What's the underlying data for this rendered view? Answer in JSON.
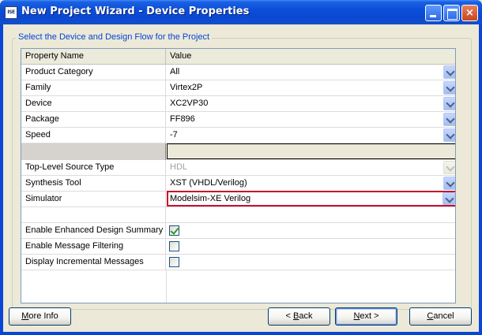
{
  "window": {
    "title": "New Project Wizard - Device Properties",
    "icon": "ISE"
  },
  "group": {
    "label": "Select the Device and Design Flow for the Project"
  },
  "grid": {
    "columns": [
      "Property Name",
      "Value"
    ],
    "rows": [
      {
        "name": "Product Category",
        "value": "All",
        "type": "combo"
      },
      {
        "name": "Family",
        "value": "Virtex2P",
        "type": "combo"
      },
      {
        "name": "Device",
        "value": "XC2VP30",
        "type": "combo"
      },
      {
        "name": "Package",
        "value": "FF896",
        "type": "combo"
      },
      {
        "name": "Speed",
        "value": "-7",
        "type": "combo"
      },
      {
        "name": "",
        "value": "",
        "type": "section"
      },
      {
        "name": "Top-Level Source Type",
        "value": "HDL",
        "type": "combo-disabled"
      },
      {
        "name": "Synthesis Tool",
        "value": "XST (VHDL/Verilog)",
        "type": "combo"
      },
      {
        "name": "Simulator",
        "value": "Modelsim-XE Verilog",
        "type": "combo-highlight"
      },
      {
        "name": "",
        "value": "",
        "type": "spacer"
      },
      {
        "name": "Enable Enhanced Design Summary",
        "checked": true,
        "type": "checkbox"
      },
      {
        "name": "Enable Message Filtering",
        "checked": false,
        "type": "checkbox"
      },
      {
        "name": "Display Incremental Messages",
        "checked": false,
        "type": "checkbox"
      }
    ]
  },
  "buttons": {
    "more_info": {
      "accel": "M",
      "rest": "ore Info"
    },
    "back": {
      "prefix": "< ",
      "accel": "B",
      "rest": "ack"
    },
    "next": {
      "accel": "N",
      "rest": "ext >"
    },
    "cancel": {
      "accel": "C",
      "rest": "ancel"
    }
  }
}
